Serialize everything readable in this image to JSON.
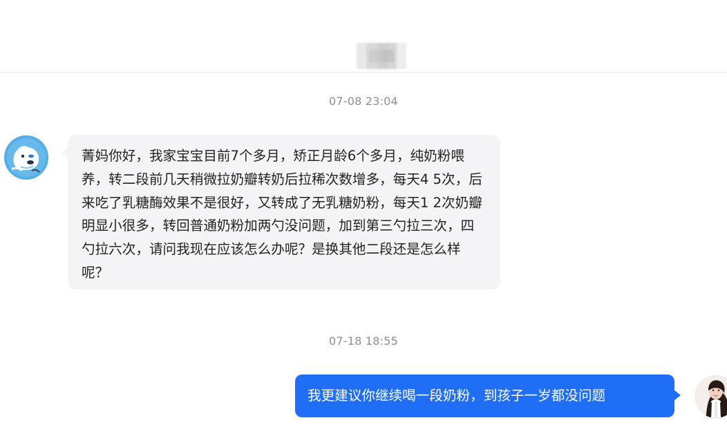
{
  "conversation": {
    "messages": [
      {
        "timestamp": "07-08 23:04",
        "direction": "incoming",
        "text": "菁妈你好，我家宝宝目前7个多月，矫正月龄6个多月，纯奶粉喂养，转二段前几天稍微拉奶瓣转奶后拉稀次数增多，每天4 5次，后来吃了乳糖酶效果不是很好，又转成了无乳糖奶粉，每天1 2次奶瓣明显小很多，转回普通奶粉加两勺没问题，加到第三勺拉三次，四勺拉六次，请问我现在应该怎么办呢？是换其他二段还是怎么样呢？"
      },
      {
        "timestamp": "07-18 18:55",
        "direction": "outgoing",
        "text": "我更建议你继续喝一段奶粉，到孩子一岁都没问题"
      }
    ]
  },
  "colors": {
    "incoming_bubble": "#f4f4f6",
    "outgoing_bubble": "#1f6ef5",
    "timestamp_text": "#8a8f99"
  },
  "icons": {
    "left_avatar": "cartoon-dog-avatar",
    "right_avatar": "woman-portrait-avatar"
  }
}
